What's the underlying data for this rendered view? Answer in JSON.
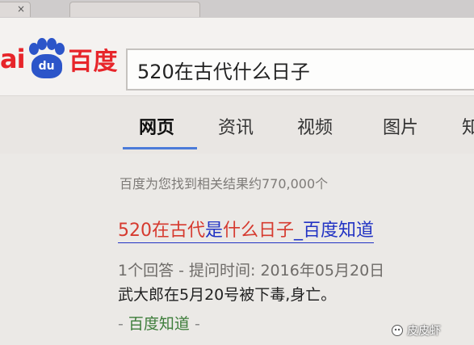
{
  "browser": {
    "tab_close": "×"
  },
  "header": {
    "logo": {
      "left_text": "ai",
      "paw_text": "du",
      "right_text": "百度"
    },
    "search": {
      "value": "520在古代什么日子"
    }
  },
  "nav": {
    "tabs": [
      {
        "label": "网页",
        "active": true
      },
      {
        "label": "资讯",
        "active": false
      },
      {
        "label": "视频",
        "active": false
      },
      {
        "label": "图片",
        "active": false
      },
      {
        "label": "知",
        "active": false
      }
    ]
  },
  "results": {
    "stats": "百度为您找到相关结果约770,000个",
    "items": [
      {
        "title_parts": [
          "520在古代",
          "是",
          "什么日子",
          "_百度知道"
        ],
        "meta": "1个回答 - 提问时间: 2016年05月20日",
        "snippet": "武大郎在5月20号被下毒,身亡。",
        "source": "百度知道",
        "source_prefix": "-",
        "source_suffix": "-"
      }
    ]
  },
  "watermark": {
    "text": "皮皮虾"
  },
  "colors": {
    "brand_red": "#e7252a",
    "brand_blue": "#2c55c9",
    "link_blue": "#2233c4",
    "keyword_red": "#d63a2f",
    "url_green": "#3d7d3a"
  }
}
